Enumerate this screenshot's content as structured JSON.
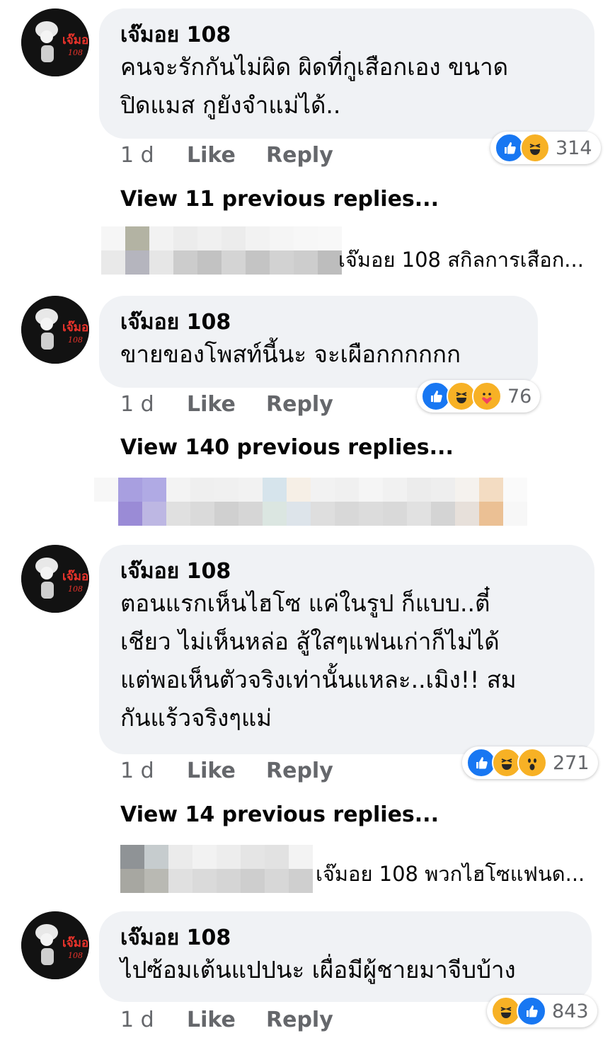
{
  "comments": [
    {
      "author": "เจ๊มอย 108",
      "avatar_text": "เจ๊มอย",
      "avatar_sub": "108",
      "text": "คนจะรักกันไม่ผิด ผิดที่กูเสือกเอง ขนาด\nปิดแมส กูยังจำแม่ได้..",
      "time": "1 d",
      "like": "Like",
      "reply": "Reply",
      "reactions": [
        "like-icon",
        "haha-icon"
      ],
      "reaction_count": "314",
      "view_replies": "View 11 previous replies...",
      "reply_preview": "เจ๊มอย 108 สกิลการเสือก..."
    },
    {
      "author": "เจ๊มอย 108",
      "avatar_text": "เจ๊มอย",
      "avatar_sub": "108",
      "text": "ขายของโพสท์นี้นะ จะเผือกกกกกก",
      "time": "1 d",
      "like": "Like",
      "reply": "Reply",
      "reactions": [
        "like-icon",
        "haha-icon",
        "care-icon"
      ],
      "reaction_count": "76",
      "view_replies": "View 140 previous replies...",
      "reply_preview": ""
    },
    {
      "author": "เจ๊มอย 108",
      "avatar_text": "เจ๊มอย",
      "avatar_sub": "108",
      "text": "ตอนแรกเห็นไฮโซ แค่ในรูป ก็แบบ..ตี๋\nเชียว ไม่เห็นหล่อ สู้ใสๆแฟนเก่าก็ไม่ได้\nแต่พอเห็นตัวจริงเท่านั้นแหละ..เมิง!! สม\nกันแร้วจริงๆแม่",
      "time": "1 d",
      "like": "Like",
      "reply": "Reply",
      "reactions": [
        "like-icon",
        "haha-icon",
        "wow-icon"
      ],
      "reaction_count": "271",
      "view_replies": "View 14 previous replies...",
      "reply_preview": "เจ๊มอย 108 พวกไฮโซแฟนด..."
    },
    {
      "author": "เจ๊มอย 108",
      "avatar_text": "เจ๊มอย",
      "avatar_sub": "108",
      "text": "ไปซ้อมเต้นแปปนะ เผื่อมีผู้ชายมาจีบบ้าง",
      "time": "1 d",
      "like": "Like",
      "reply": "Reply",
      "reactions": [
        "haha-icon",
        "like-icon"
      ],
      "reaction_count": "843",
      "view_replies": "",
      "reply_preview": ""
    }
  ],
  "colors": {
    "bubble": "#f0f2f5",
    "like": "#1877f2",
    "emoji": "#f7b125",
    "meta": "#65676b"
  }
}
